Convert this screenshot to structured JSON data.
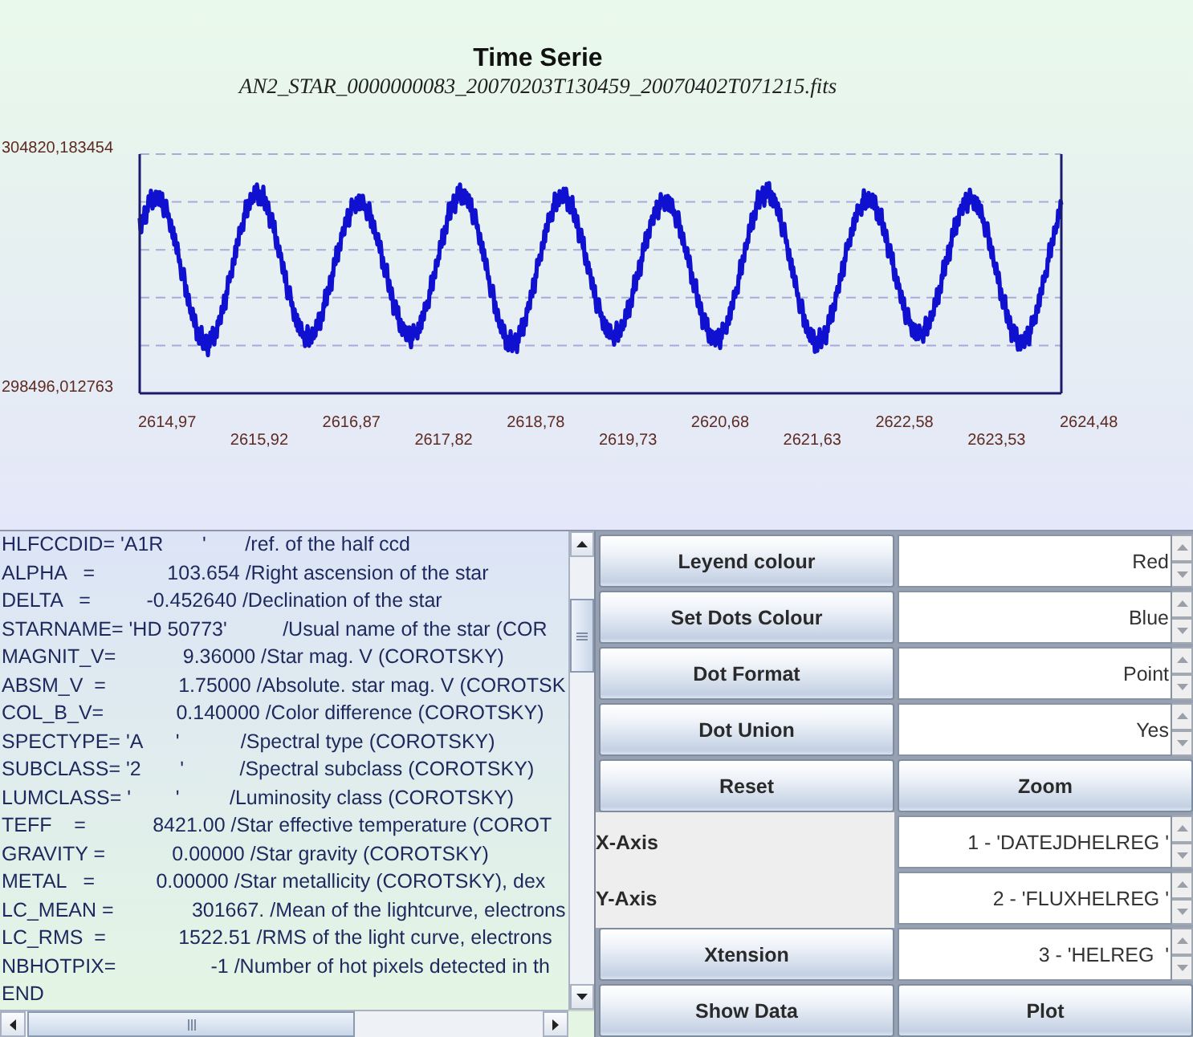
{
  "chart": {
    "title": "Time Serie",
    "file_name": "AN2_STAR_0000000083_20070203T130459_20070402T071215.fits",
    "y_labels": [
      "304820,183454",
      "298496,012763"
    ],
    "x_labels": [
      "2614,97",
      "2615,92",
      "2616,87",
      "2617,82",
      "2618,78",
      "2619,73",
      "2620,68",
      "2621,63",
      "2622,58",
      "2623,53",
      "2624,48"
    ]
  },
  "header_listing": {
    "lines": [
      "HLFCCDID= 'A1R       '       /ref. of the half ccd",
      "ALPHA   =             103.654 /Right ascension of the star",
      "DELTA   =          -0.452640 /Declination of the star",
      "STARNAME= 'HD 50773'          /Usual name of the star (COR",
      "MAGNIT_V=            9.36000 /Star mag. V (COROTSKY)",
      "ABSM_V  =             1.75000 /Absolute. star mag. V (COROTSK",
      "COL_B_V=             0.140000 /Color difference (COROTSKY)",
      "SPECTYPE= 'A      '           /Spectral type (COROTSKY)",
      "SUBCLASS= '2       '          /Spectral subclass (COROTSKY)",
      "LUMCLASS= '        '         /Luminosity class (COROTSKY)",
      "TEFF    =            8421.00 /Star effective temperature (COROT",
      "GRAVITY =            0.00000 /Star gravity (COROTSKY)",
      "METAL   =           0.00000 /Star metallicity (COROTSKY), dex",
      "LC_MEAN =              301667. /Mean of the lightcurve, electrons",
      "LC_RMS  =             1522.51 /RMS of the light curve, electrons",
      "NBHOTPIX=                 -1 /Number of hot pixels detected in th",
      "END"
    ]
  },
  "controls": {
    "rows": [
      {
        "kind": "button_spinner",
        "button": "Leyend colour",
        "value": "Red"
      },
      {
        "kind": "button_spinner",
        "button": "Set Dots Colour",
        "value": "Blue"
      },
      {
        "kind": "button_spinner",
        "button": "Dot Format",
        "value": "Point"
      },
      {
        "kind": "button_spinner",
        "button": "Dot Union",
        "value": "Yes"
      },
      {
        "kind": "button_pair",
        "buttons": [
          "Reset",
          "Zoom"
        ]
      },
      {
        "kind": "label_spinner",
        "label": "X-Axis",
        "value": "1 - 'DATEJDHELREG '"
      },
      {
        "kind": "label_spinner",
        "label": "Y-Axis",
        "value": "2 - 'FLUXHELREG '"
      },
      {
        "kind": "button_spinner",
        "button": "Xtension",
        "value": "3 - 'HELREG  '"
      },
      {
        "kind": "button_pair",
        "buttons": [
          "Show Data",
          "Plot"
        ]
      }
    ]
  }
}
